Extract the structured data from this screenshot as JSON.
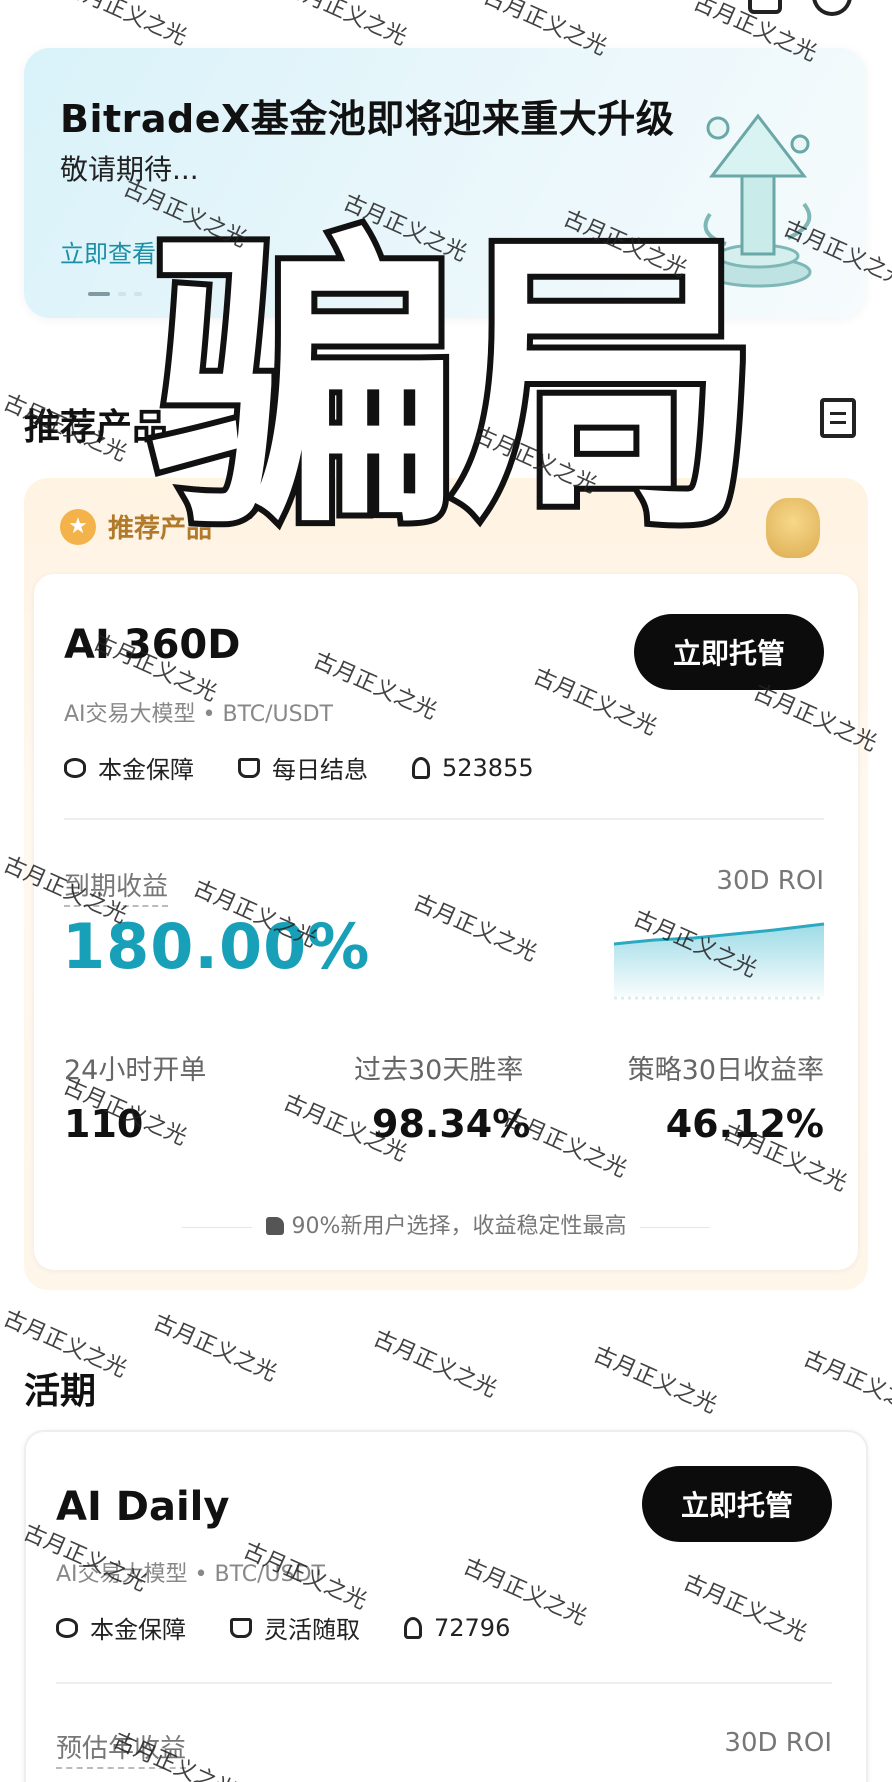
{
  "banner": {
    "title": "BitradeX基金池即将迎来重大升级",
    "subtitle": "敬请期待...",
    "link_label": "立即查看"
  },
  "sections": {
    "recommended_title": "推荐产品",
    "recommended_badge": "推荐产品",
    "flexible_title": "活期"
  },
  "products": [
    {
      "name": "AI 360D",
      "subtitle": "AI交易大模型 • BTC/USDT",
      "button": "立即托管",
      "features": [
        "本金保障",
        "每日结息",
        "523855"
      ],
      "yield_label": "到期收益",
      "yield_value": "180.00%",
      "roi_label": "30D ROI",
      "stats": [
        {
          "label": "24小时开单",
          "value": "110"
        },
        {
          "label": "过去30天胜率",
          "value": "98.34%"
        },
        {
          "label": "策略30日收益率",
          "value": "46.12%"
        }
      ],
      "note": "90%新用户选择，收益稳定性最高"
    },
    {
      "name": "AI Daily",
      "subtitle": "AI交易大模型 • BTC/USDT",
      "button": "立即托管",
      "features": [
        "本金保障",
        "灵活随取",
        "72796"
      ],
      "yield_label": "预估年收益",
      "roi_label": "30D ROI"
    }
  ],
  "overlay_text": "骗局",
  "watermark": "古月正义之光",
  "colors": {
    "accent": "#18a0b8",
    "link": "#1b8fa6",
    "button": "#0c0c0c",
    "rec_bg": "#fff3e2"
  },
  "icons": [
    "coins-icon",
    "moneybag-icon",
    "user-icon",
    "document-icon",
    "star-icon",
    "thumbs-up-icon",
    "chevron-right-icon"
  ]
}
